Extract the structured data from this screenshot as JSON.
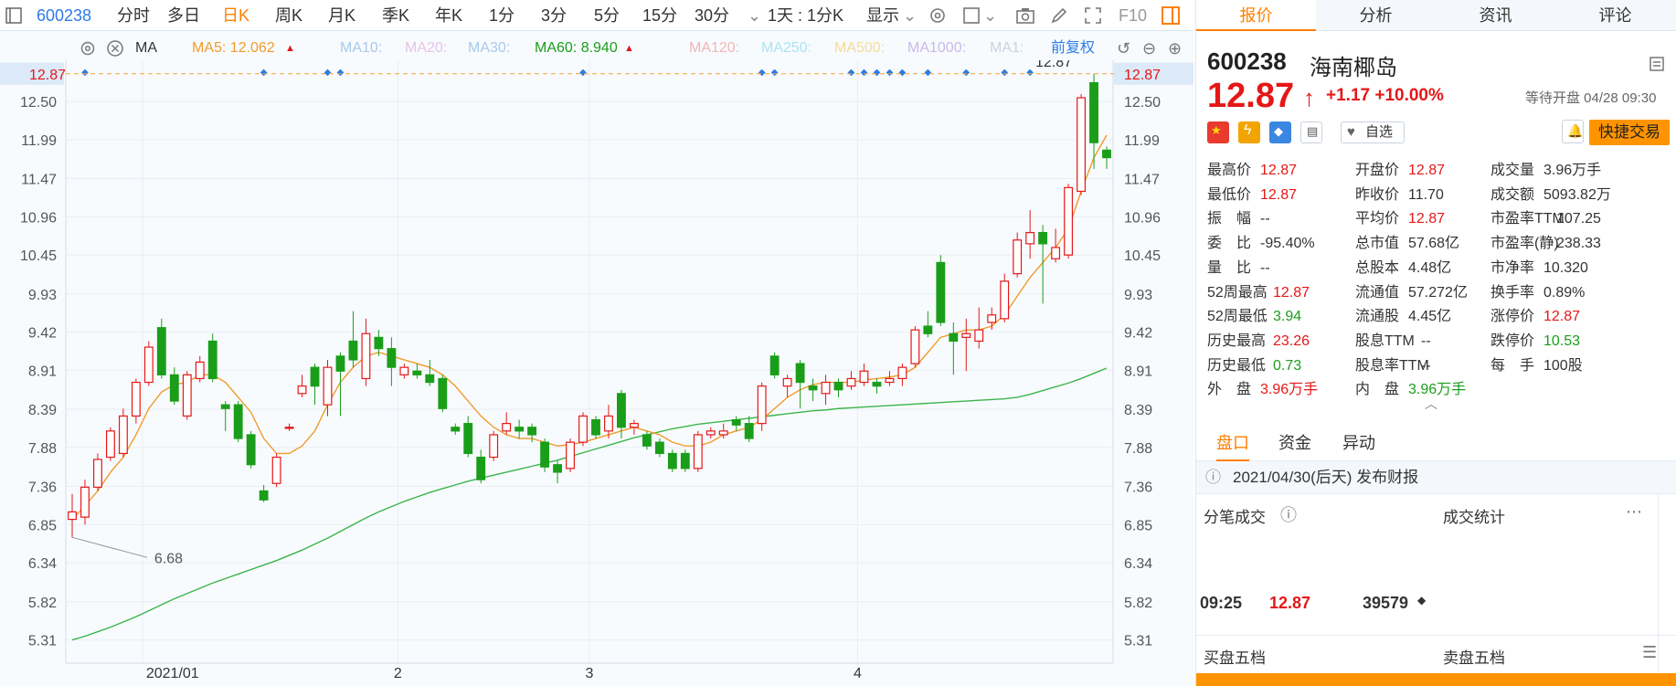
{
  "toolbar": {
    "code": "600238",
    "periods": [
      "分时",
      "多日",
      "日K",
      "周K",
      "月K",
      "季K",
      "年K",
      "1分",
      "3分",
      "5分",
      "15分",
      "30分"
    ],
    "active": "日K",
    "interval": "1天 : 1分K",
    "display": "显示",
    "f10": "F10"
  },
  "ma": {
    "label": "MA",
    "ma5": "MA5: 12.062",
    "ma10": "MA10:",
    "ma20": "MA20:",
    "ma30": "MA30:",
    "ma60": "MA60: 8.940",
    "ma120": "MA120:",
    "ma250": "MA250:",
    "ma500": "MA500:",
    "ma1000": "MA1000:",
    "ma1": "MA1:",
    "adjust": "前复权"
  },
  "colors": {
    "up": "#e51717",
    "down": "#1a9e1a",
    "ma5": "#f29a2b",
    "ma60": "#3ab54a",
    "accent": "#ff7f00"
  },
  "chart_data": {
    "type": "candlestick",
    "yticks": [
      "12.50",
      "11.99",
      "11.47",
      "10.96",
      "10.45",
      "9.93",
      "9.42",
      "8.91",
      "8.39",
      "7.88",
      "7.36",
      "6.85",
      "6.34",
      "5.82",
      "5.31"
    ],
    "ylim": [
      5.0,
      13.05
    ],
    "xticks": [
      {
        "label": "2021/01",
        "i": 6
      },
      {
        "label": "2",
        "i": 26
      },
      {
        "label": "3",
        "i": 41
      },
      {
        "label": "4",
        "i": 62
      }
    ],
    "current": "12.87",
    "high_label": "12.87",
    "low_label": "6.68",
    "ohlc": [
      [
        6.92,
        7.02,
        7.26,
        6.68
      ],
      [
        6.95,
        7.35,
        7.45,
        6.85
      ],
      [
        7.35,
        7.72,
        7.8,
        7.3
      ],
      [
        7.75,
        8.1,
        8.15,
        7.7
      ],
      [
        7.8,
        8.3,
        8.4,
        7.75
      ],
      [
        8.3,
        8.75,
        8.8,
        8.2
      ],
      [
        8.75,
        9.22,
        9.3,
        8.7
      ],
      [
        9.48,
        8.85,
        9.6,
        8.8
      ],
      [
        8.85,
        8.5,
        8.95,
        8.45
      ],
      [
        8.3,
        8.85,
        8.9,
        8.25
      ],
      [
        8.8,
        9.02,
        9.1,
        8.75
      ],
      [
        9.3,
        8.8,
        9.4,
        8.75
      ],
      [
        8.45,
        8.4,
        8.5,
        8.1
      ],
      [
        8.45,
        8.0,
        8.5,
        7.95
      ],
      [
        8.05,
        7.65,
        8.1,
        7.6
      ],
      [
        7.3,
        7.18,
        7.38,
        7.15
      ],
      [
        7.4,
        7.75,
        7.8,
        7.35
      ],
      [
        8.15,
        8.15,
        8.2,
        8.1
      ],
      [
        8.6,
        8.7,
        8.85,
        8.55
      ],
      [
        8.95,
        8.7,
        9.0,
        8.45
      ],
      [
        8.45,
        8.95,
        9.05,
        8.3
      ],
      [
        9.1,
        8.9,
        9.15,
        8.3
      ],
      [
        9.3,
        9.05,
        9.7,
        8.95
      ],
      [
        8.8,
        9.4,
        9.6,
        8.7
      ],
      [
        9.35,
        9.2,
        9.45,
        9.1
      ],
      [
        9.2,
        8.95,
        9.35,
        8.7
      ],
      [
        8.85,
        8.95,
        9.0,
        8.8
      ],
      [
        8.9,
        8.85,
        9.0,
        8.8
      ],
      [
        8.85,
        8.75,
        9.05,
        8.7
      ],
      [
        8.8,
        8.4,
        8.85,
        8.35
      ],
      [
        8.15,
        8.1,
        8.2,
        8.05
      ],
      [
        8.2,
        7.8,
        8.3,
        7.75
      ],
      [
        7.75,
        7.45,
        7.85,
        7.4
      ],
      [
        7.75,
        8.05,
        8.1,
        7.7
      ],
      [
        8.1,
        8.2,
        8.35,
        8.05
      ],
      [
        8.15,
        8.1,
        8.25,
        8.0
      ],
      [
        8.15,
        8.05,
        8.2,
        7.95
      ],
      [
        7.95,
        7.62,
        8.0,
        7.55
      ],
      [
        7.65,
        7.55,
        7.7,
        7.4
      ],
      [
        7.6,
        7.95,
        8.0,
        7.55
      ],
      [
        7.95,
        8.3,
        8.35,
        7.9
      ],
      [
        8.25,
        8.05,
        8.3,
        8.0
      ],
      [
        8.1,
        8.3,
        8.45,
        8.0
      ],
      [
        8.6,
        8.15,
        8.65,
        8.0
      ],
      [
        8.15,
        8.2,
        8.25,
        8.05
      ],
      [
        8.05,
        7.9,
        8.1,
        7.85
      ],
      [
        7.95,
        7.8,
        8.0,
        7.75
      ],
      [
        7.8,
        7.6,
        7.85,
        7.55
      ],
      [
        7.8,
        7.6,
        7.85,
        7.55
      ],
      [
        7.6,
        8.05,
        8.1,
        7.55
      ],
      [
        8.05,
        8.1,
        8.15,
        8.0
      ],
      [
        8.05,
        8.1,
        8.2,
        8.0
      ],
      [
        8.25,
        8.18,
        8.3,
        8.1
      ],
      [
        8.2,
        8.0,
        8.3,
        7.95
      ],
      [
        8.2,
        8.7,
        8.75,
        8.1
      ],
      [
        9.1,
        8.85,
        9.15,
        8.8
      ],
      [
        8.7,
        8.8,
        8.85,
        8.55
      ],
      [
        9.0,
        8.75,
        9.05,
        8.4
      ],
      [
        8.7,
        8.65,
        8.8,
        8.5
      ],
      [
        8.6,
        8.75,
        8.85,
        8.45
      ],
      [
        8.75,
        8.65,
        8.8,
        8.55
      ],
      [
        8.7,
        8.8,
        8.9,
        8.65
      ],
      [
        8.75,
        8.9,
        9.0,
        8.7
      ],
      [
        8.75,
        8.7,
        8.8,
        8.6
      ],
      [
        8.75,
        8.8,
        8.9,
        8.7
      ],
      [
        8.8,
        8.95,
        9.0,
        8.7
      ],
      [
        9.0,
        9.45,
        9.5,
        8.95
      ],
      [
        9.5,
        9.4,
        9.7,
        9.35
      ],
      [
        10.35,
        9.55,
        10.45,
        9.5
      ],
      [
        9.4,
        9.3,
        9.55,
        8.85
      ],
      [
        9.35,
        9.4,
        9.6,
        8.9
      ],
      [
        9.3,
        9.45,
        9.75,
        9.2
      ],
      [
        9.55,
        9.65,
        9.75,
        9.45
      ],
      [
        9.6,
        10.1,
        10.2,
        9.55
      ],
      [
        10.2,
        10.65,
        10.75,
        10.15
      ],
      [
        10.6,
        10.75,
        11.05,
        10.4
      ],
      [
        10.75,
        10.6,
        10.85,
        9.8
      ],
      [
        10.4,
        10.55,
        10.8,
        10.35
      ],
      [
        10.45,
        11.35,
        11.4,
        10.4
      ],
      [
        11.3,
        12.55,
        12.6,
        11.25
      ],
      [
        12.75,
        11.95,
        12.87,
        11.6
      ],
      [
        11.85,
        11.75,
        11.9,
        11.6
      ]
    ],
    "ma5": [
      6.92,
      7.1,
      7.3,
      7.55,
      7.75,
      8.05,
      8.4,
      8.62,
      8.72,
      8.75,
      8.85,
      8.85,
      8.75,
      8.55,
      8.35,
      8.0,
      7.8,
      7.8,
      7.9,
      8.1,
      8.45,
      8.75,
      8.95,
      9.1,
      9.15,
      9.1,
      9.05,
      9.0,
      8.95,
      8.85,
      8.7,
      8.5,
      8.3,
      8.15,
      8.05,
      8.0,
      8.0,
      7.95,
      7.9,
      7.92,
      7.95,
      8.0,
      8.05,
      8.1,
      8.15,
      8.1,
      8.05,
      7.95,
      7.9,
      7.9,
      7.95,
      8.05,
      8.1,
      8.15,
      8.25,
      8.4,
      8.55,
      8.65,
      8.72,
      8.75,
      8.75,
      8.75,
      8.78,
      8.8,
      8.82,
      8.85,
      8.95,
      9.15,
      9.35,
      9.4,
      9.45,
      9.45,
      9.5,
      9.65,
      9.9,
      10.15,
      10.35,
      10.55,
      10.8,
      11.3,
      11.75,
      12.05
    ],
    "ma60": [
      5.31,
      5.36,
      5.42,
      5.48,
      5.55,
      5.62,
      5.7,
      5.78,
      5.86,
      5.93,
      6.0,
      6.07,
      6.13,
      6.19,
      6.25,
      6.31,
      6.37,
      6.44,
      6.51,
      6.59,
      6.67,
      6.76,
      6.85,
      6.94,
      7.02,
      7.09,
      7.16,
      7.22,
      7.28,
      7.33,
      7.38,
      7.43,
      7.47,
      7.51,
      7.55,
      7.59,
      7.63,
      7.67,
      7.71,
      7.76,
      7.81,
      7.86,
      7.91,
      7.96,
      8.01,
      8.05,
      8.09,
      8.13,
      8.16,
      8.19,
      8.21,
      8.23,
      8.25,
      8.27,
      8.29,
      8.31,
      8.33,
      8.35,
      8.37,
      8.38,
      8.4,
      8.41,
      8.42,
      8.43,
      8.44,
      8.45,
      8.46,
      8.47,
      8.48,
      8.49,
      8.5,
      8.51,
      8.52,
      8.53,
      8.55,
      8.59,
      8.64,
      8.69,
      8.74,
      8.8,
      8.87,
      8.94
    ],
    "markers": [
      1,
      15,
      20,
      21,
      40,
      54,
      55,
      61,
      62,
      63,
      64,
      65,
      67,
      70,
      73,
      75
    ]
  },
  "quote": {
    "code": "600238",
    "name": "海南椰岛",
    "price": "12.87",
    "change": "+1.17",
    "pct": "+10.00%",
    "status": "等待开盘 04/28 09:30",
    "selfsel": "自选",
    "fasttrade": "快捷交易",
    "col1": [
      [
        "最高价",
        "12.87",
        "red"
      ],
      [
        "最低价",
        "12.87",
        "red"
      ],
      [
        "振　幅",
        "--",
        "dark"
      ],
      [
        "委　比",
        "-95.40%",
        "dark"
      ],
      [
        "量　比",
        "--",
        "dark"
      ],
      [
        "52周最高",
        "12.87",
        "red"
      ],
      [
        "52周最低",
        "3.94",
        "green"
      ],
      [
        "历史最高",
        "23.26",
        "red"
      ],
      [
        "历史最低",
        "0.73",
        "green"
      ],
      [
        "外　盘",
        "3.96万手",
        "red"
      ]
    ],
    "col2": [
      [
        "开盘价",
        "12.87",
        "red"
      ],
      [
        "昨收价",
        "11.70",
        "dark"
      ],
      [
        "平均价",
        "12.87",
        "red"
      ],
      [
        "总市值",
        "57.68亿",
        "dark"
      ],
      [
        "总股本",
        "4.48亿",
        "dark"
      ],
      [
        "流通值",
        "57.272亿",
        "dark"
      ],
      [
        "流通股",
        "4.45亿",
        "dark"
      ],
      [
        "股息TTM",
        "--",
        "dark"
      ],
      [
        "股息率TTM",
        "--",
        "dark"
      ],
      [
        "内　盘",
        "3.96万手",
        "green"
      ]
    ],
    "col3": [
      [
        "成交量",
        "3.96万手",
        "dark"
      ],
      [
        "成交额",
        "5093.82万",
        "dark"
      ],
      [
        "市盈率TTM",
        "107.25",
        "dark"
      ],
      [
        "市盈率(静)",
        "238.33",
        "dark"
      ],
      [
        "市净率",
        "10.320",
        "dark"
      ],
      [
        "换手率",
        "0.89%",
        "dark"
      ],
      [
        "涨停价",
        "12.87",
        "red"
      ],
      [
        "跌停价",
        "10.53",
        "green"
      ],
      [
        "每　手",
        "100股",
        "dark"
      ]
    ]
  },
  "righttabs": [
    "报价",
    "分析",
    "资讯",
    "评论"
  ],
  "subtabs": [
    "盘口",
    "资金",
    "异动"
  ],
  "notice": "2021/04/30(后天)  发布财报",
  "ticks": {
    "title": "分笔成交",
    "stats": "成交统计",
    "time": "09:25",
    "price": "12.87",
    "vol": "39579"
  },
  "book": {
    "buy": "买盘五档",
    "sell": "卖盘五档"
  }
}
